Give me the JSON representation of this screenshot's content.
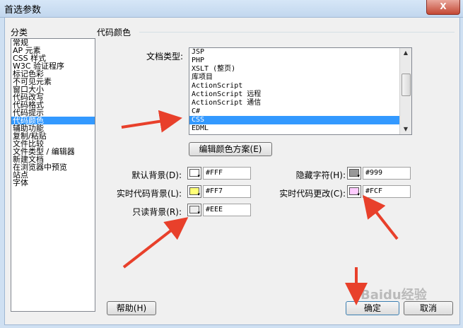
{
  "window": {
    "title": "首选参数",
    "close_label": "X"
  },
  "sidebar": {
    "label": "分类",
    "items": [
      {
        "label": "常规"
      },
      {
        "label": "AP 元素"
      },
      {
        "label": "CSS 样式"
      },
      {
        "label": "W3C 验证程序"
      },
      {
        "label": "标记色彩"
      },
      {
        "label": "不可见元素"
      },
      {
        "label": "窗口大小"
      },
      {
        "label": "代码改写"
      },
      {
        "label": "代码格式"
      },
      {
        "label": "代码提示"
      },
      {
        "label": "代码颜色",
        "selected": true
      },
      {
        "label": "辅助功能"
      },
      {
        "label": "复制/粘贴"
      },
      {
        "label": "文件比较"
      },
      {
        "label": "文件类型 / 编辑器"
      },
      {
        "label": "新建文档"
      },
      {
        "label": "在浏览器中预览"
      },
      {
        "label": "站点"
      },
      {
        "label": "字体"
      }
    ]
  },
  "main": {
    "section_title": "代码颜色",
    "doc_type_label": "文档类型:",
    "doc_types": [
      {
        "label": "JSP"
      },
      {
        "label": "PHP"
      },
      {
        "label": "XSLT (整页)"
      },
      {
        "label": "库项目"
      },
      {
        "label": "ActionScript"
      },
      {
        "label": "ActionScript 远程"
      },
      {
        "label": "ActionScript 通信"
      },
      {
        "label": "C#"
      },
      {
        "label": "CSS",
        "selected": true
      },
      {
        "label": "EDML"
      }
    ],
    "edit_scheme_button": "编辑颜色方案(E)",
    "colors": {
      "default_bg": {
        "label": "默认背景(D):",
        "value": "#FFF",
        "color": "#ffffff"
      },
      "live_code_bg": {
        "label": "实时代码背景(L):",
        "value": "#FF7",
        "color": "#ffff77"
      },
      "readonly_bg": {
        "label": "只读背景(R):",
        "value": "#EEE",
        "color": "#eeeeee"
      },
      "hidden_chars": {
        "label": "隐藏字符(H):",
        "value": "#999",
        "color": "#999999"
      },
      "live_code_changes": {
        "label": "实时代码更改(C):",
        "value": "#FCF",
        "color": "#ffccff"
      }
    }
  },
  "footer": {
    "help": "帮助(H)",
    "ok": "确定",
    "cancel": "取消"
  },
  "watermark": "Baidu经验"
}
